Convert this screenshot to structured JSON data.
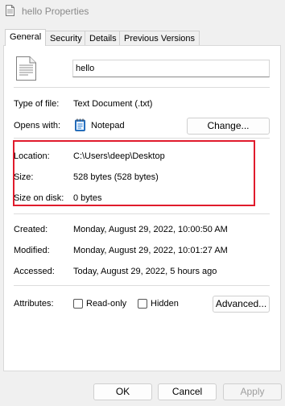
{
  "window": {
    "title": "hello Properties"
  },
  "tabs": [
    {
      "label": "General"
    },
    {
      "label": "Security"
    },
    {
      "label": "Details"
    },
    {
      "label": "Previous Versions"
    }
  ],
  "general": {
    "file_name": "hello",
    "type_label": "Type of file:",
    "type_value": "Text Document (.txt)",
    "opens_label": "Opens with:",
    "opens_value": "Notepad",
    "change_button": "Change...",
    "location_label": "Location:",
    "location_value": "C:\\Users\\deep\\Desktop",
    "size_label": "Size:",
    "size_value": "528 bytes (528 bytes)",
    "size_disk_label": "Size on disk:",
    "size_disk_value": "0 bytes",
    "created_label": "Created:",
    "created_value": "Monday, August 29, 2022, 10:00:50 AM",
    "modified_label": "Modified:",
    "modified_value": "Monday, August 29, 2022, 10:01:27 AM",
    "accessed_label": "Accessed:",
    "accessed_value": "Today, August 29, 2022, 5 hours ago",
    "attributes_label": "Attributes:",
    "readonly_label": "Read-only",
    "hidden_label": "Hidden",
    "advanced_button": "Advanced..."
  },
  "footer": {
    "ok_button": "OK",
    "cancel_button": "Cancel",
    "apply_button": "Apply"
  },
  "colors": {
    "highlight_border": "#e01b2c",
    "notepad_icon": "#2f7fd4"
  }
}
